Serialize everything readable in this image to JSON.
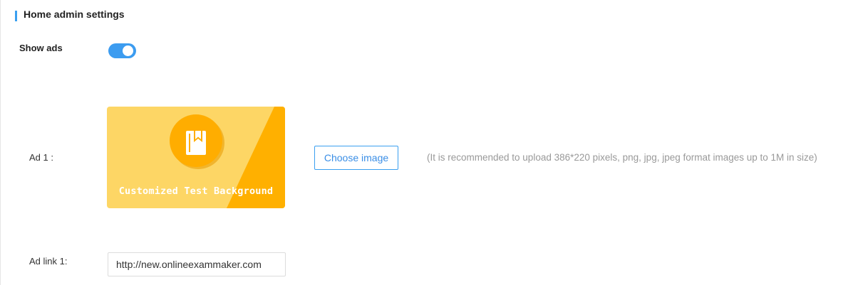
{
  "section": {
    "title": "Home admin settings",
    "accent_color": "#3a9ff0"
  },
  "show_ads": {
    "label": "Show ads",
    "enabled": true,
    "toggle_color": "#3c9cf0"
  },
  "ad1": {
    "label": "Ad 1 :",
    "image": {
      "caption": "Customized Test Background",
      "icon": "book-icon",
      "colors": {
        "background": "#fdd665",
        "stripe": "#ffb000",
        "circle": "#ffad00"
      }
    },
    "choose_button_label": "Choose image",
    "hint": "(It is recommended to upload 386*220 pixels, png, jpg, jpeg format images up to 1M in size)"
  },
  "ad_link1": {
    "label": "Ad link 1:",
    "value": "http://new.onlineexammaker.com"
  }
}
